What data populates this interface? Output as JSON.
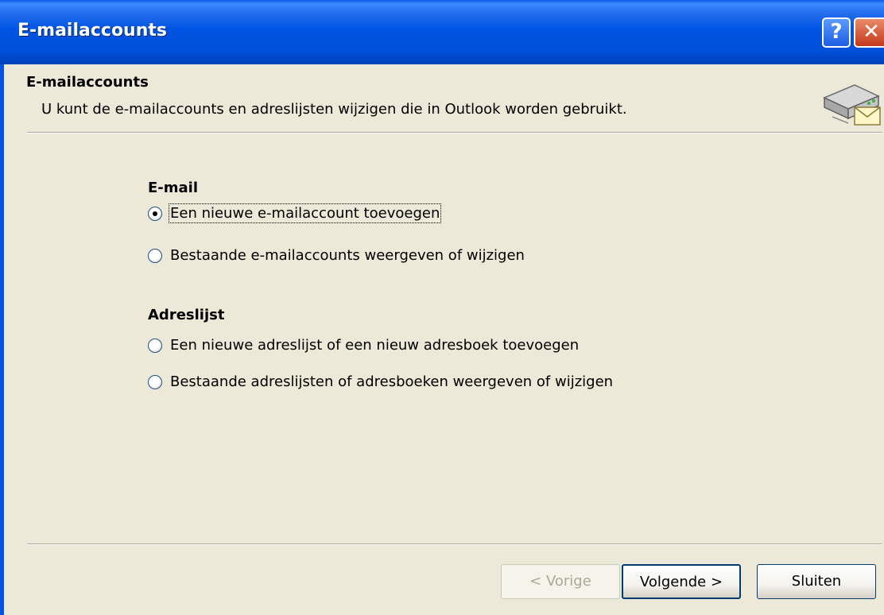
{
  "window": {
    "title": "E-mailaccounts",
    "help_button": "?",
    "close_button": "✕"
  },
  "header": {
    "title": "E-mailaccounts",
    "subtitle": "U kunt de e-mailaccounts en adreslijsten wijzigen die in Outlook worden gebruikt.",
    "icon": "mail-server-icon"
  },
  "email_group": {
    "title": "E-mail",
    "options": [
      {
        "label": "Een nieuwe e-mailaccount toevoegen",
        "checked": true
      },
      {
        "label": "Bestaande e-mailaccounts weergeven of wijzigen",
        "checked": false
      }
    ]
  },
  "address_group": {
    "title": "Adreslijst",
    "options": [
      {
        "label": "Een nieuwe adreslijst of een nieuw adresboek toevoegen",
        "checked": false
      },
      {
        "label": "Bestaande adreslijsten of adresboeken weergeven of wijzigen",
        "checked": false
      }
    ]
  },
  "buttons": {
    "back": "< Vorige",
    "next": "Volgende >",
    "close": "Sluiten"
  },
  "colors": {
    "titlebar": "#0054E3",
    "dialog_bg": "#ECE9D8"
  }
}
